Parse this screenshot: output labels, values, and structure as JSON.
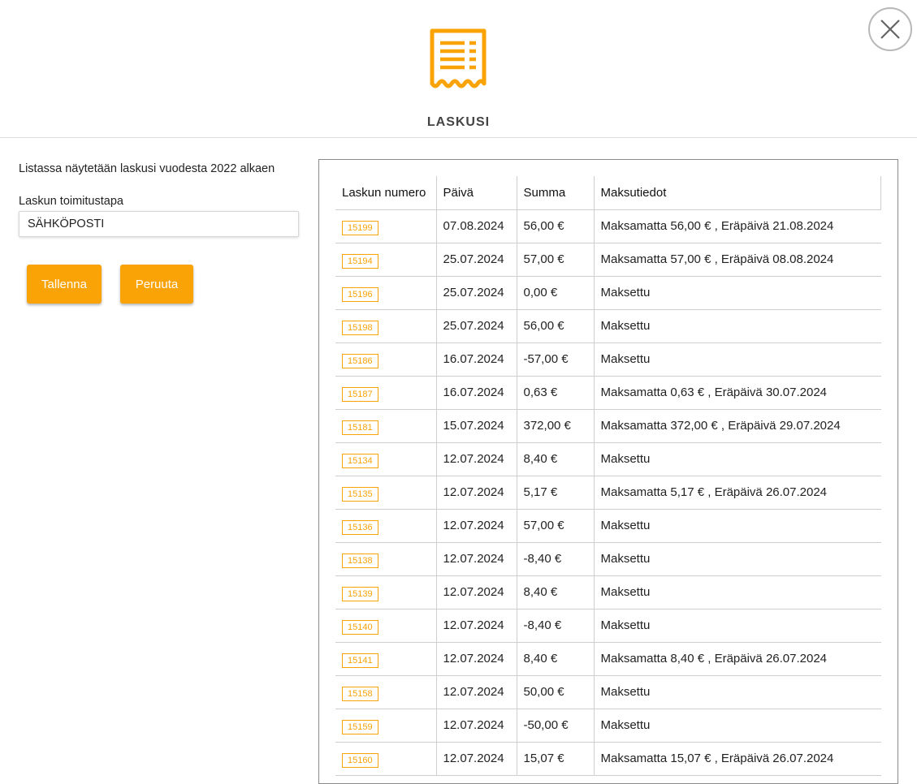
{
  "header": {
    "title": "LASKUSI",
    "icon": "receipt-icon",
    "accent_color": "#f9a307"
  },
  "close": {
    "icon": "close-icon"
  },
  "left": {
    "info_text": "Listassa näytetään laskusi vuodesta 2022 alkaen",
    "delivery_label": "Laskun toimitustapa",
    "delivery_value": "SÄHKÖPOSTI",
    "save_label": "Tallenna",
    "cancel_label": "Peruuta"
  },
  "table": {
    "headers": [
      "Laskun numero",
      "Päivä",
      "Summa",
      "Maksutiedot"
    ],
    "rows": [
      [
        "15199",
        "07.08.2024",
        "56,00 €",
        "Maksamatta 56,00 € , Eräpäivä 21.08.2024"
      ],
      [
        "15194",
        "25.07.2024",
        "57,00 €",
        "Maksamatta 57,00 € , Eräpäivä 08.08.2024"
      ],
      [
        "15196",
        "25.07.2024",
        "0,00 €",
        "Maksettu"
      ],
      [
        "15198",
        "25.07.2024",
        "56,00 €",
        "Maksettu"
      ],
      [
        "15186",
        "16.07.2024",
        "-57,00 €",
        "Maksettu"
      ],
      [
        "15187",
        "16.07.2024",
        "0,63 €",
        "Maksamatta 0,63 € , Eräpäivä 30.07.2024"
      ],
      [
        "15181",
        "15.07.2024",
        "372,00 €",
        "Maksamatta 372,00 € , Eräpäivä 29.07.2024"
      ],
      [
        "15134",
        "12.07.2024",
        "8,40 €",
        "Maksettu"
      ],
      [
        "15135",
        "12.07.2024",
        "5,17 €",
        "Maksamatta 5,17 € , Eräpäivä 26.07.2024"
      ],
      [
        "15136",
        "12.07.2024",
        "57,00 €",
        "Maksettu"
      ],
      [
        "15138",
        "12.07.2024",
        "-8,40 €",
        "Maksettu"
      ],
      [
        "15139",
        "12.07.2024",
        "8,40 €",
        "Maksettu"
      ],
      [
        "15140",
        "12.07.2024",
        "-8,40 €",
        "Maksettu"
      ],
      [
        "15141",
        "12.07.2024",
        "8,40 €",
        "Maksamatta 8,40 € , Eräpäivä 26.07.2024"
      ],
      [
        "15158",
        "12.07.2024",
        "50,00 €",
        "Maksettu"
      ],
      [
        "15159",
        "12.07.2024",
        "-50,00 €",
        "Maksettu"
      ],
      [
        "15160",
        "12.07.2024",
        "15,07 €",
        "Maksamatta 15,07 € , Eräpäivä 26.07.2024"
      ]
    ]
  }
}
